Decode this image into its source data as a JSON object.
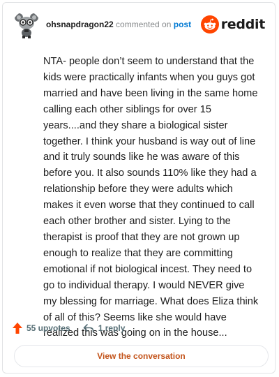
{
  "header": {
    "username": "ohsnapdragon22",
    "action_text": "commented on",
    "post_link": "post",
    "brand": "reddit"
  },
  "comment": {
    "text": "NTA- people don’t seem to understand that the kids were practically infants when you guys got married and have been living in the same home calling each other siblings for over 15 years....and they share a biological sister together. I think your husband is way out of line and it truly sounds like he was aware of this before you. It also sounds 110% like they had a relationship before they were adults which makes it even worse that they continued to call each other brother and sister. Lying to the therapist is proof that they are not grown up enough to realize that they are committing emotional if not biological incest. They need to go to individual therapy. I would NEVER give my blessing for marriage. What does Eliza think of all of this? Seems like she would have realized this was going on in the house..."
  },
  "actions": {
    "upvotes": "55 upvotes",
    "replies": "1 reply"
  },
  "footer": {
    "view_conversation": "View the conversation"
  },
  "colors": {
    "brand_orange": "#ff4500",
    "link_blue": "#0079d3",
    "cta_text": "#c3541b",
    "muted": "#878a8c"
  },
  "icons": {
    "avatar": "snoo-avatar-icon",
    "brand": "reddit-logo-icon",
    "upvote": "upvote-arrow-icon",
    "reply": "reply-arrow-icon"
  }
}
